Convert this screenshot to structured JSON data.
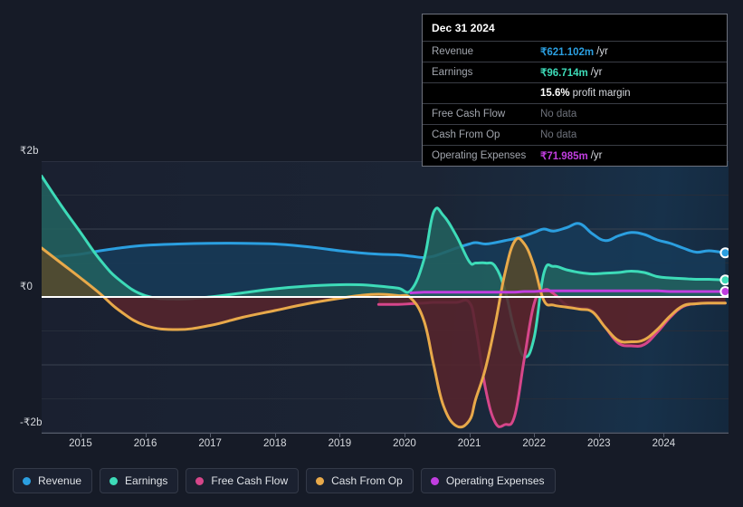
{
  "tooltip": {
    "date": "Dec 31 2024",
    "rows": [
      {
        "label": "Revenue",
        "value": "₹621.102m",
        "suffix": "/yr",
        "style": "v-revenue"
      },
      {
        "label": "Earnings",
        "value": "₹96.714m",
        "suffix": "/yr",
        "style": "v-earnings"
      },
      {
        "label": "",
        "value": "15.6%",
        "suffix": "profit margin",
        "style": "v-white"
      },
      {
        "label": "Free Cash Flow",
        "value": "No data",
        "suffix": "",
        "style": "nodata"
      },
      {
        "label": "Cash From Op",
        "value": "No data",
        "suffix": "",
        "style": "nodata"
      },
      {
        "label": "Operating Expenses",
        "value": "₹71.985m",
        "suffix": "/yr",
        "style": "v-opex"
      }
    ]
  },
  "legend": {
    "items": [
      {
        "label": "Revenue",
        "color": "#2b9fe0"
      },
      {
        "label": "Earnings",
        "color": "#3ddbb8"
      },
      {
        "label": "Free Cash Flow",
        "color": "#d6468a"
      },
      {
        "label": "Cash From Op",
        "color": "#e8a94a"
      },
      {
        "label": "Operating Expenses",
        "color": "#c13ee0"
      }
    ]
  },
  "chart_data": {
    "type": "area",
    "title": "",
    "xlabel": "",
    "ylabel": "",
    "currency": "₹",
    "units": "billions",
    "grid": true,
    "legend_position": "bottom",
    "ylim": [
      -2,
      2
    ],
    "yticks": [
      2,
      1,
      0,
      -1,
      -2
    ],
    "ytick_labels": [
      "₹2b",
      "",
      "₹0",
      "",
      "-₹2b"
    ],
    "gridline_values": [
      2,
      1.5,
      1,
      0.5,
      0,
      -0.5,
      -1,
      -1.5,
      -2
    ],
    "xlim": [
      2014.4,
      2025.0
    ],
    "xticks": [
      2015,
      2016,
      2017,
      2018,
      2019,
      2020,
      2021,
      2022,
      2023,
      2024
    ],
    "xtick_labels": [
      "2015",
      "2016",
      "2017",
      "2018",
      "2019",
      "2020",
      "2021",
      "2022",
      "2023",
      "2024"
    ],
    "zero_line": 0,
    "x": [
      2014.4,
      2014.7,
      2015.0,
      2015.3,
      2015.6,
      2016.0,
      2016.5,
      2017.0,
      2017.5,
      2018.0,
      2018.5,
      2019.0,
      2019.3,
      2019.6,
      2019.9,
      2020.1,
      2020.3,
      2020.45,
      2020.6,
      2020.8,
      2021.0,
      2021.1,
      2021.25,
      2021.4,
      2021.55,
      2021.7,
      2021.85,
      2022.0,
      2022.15,
      2022.3,
      2022.5,
      2022.7,
      2022.9,
      2023.1,
      2023.3,
      2023.5,
      2023.7,
      2023.9,
      2024.1,
      2024.3,
      2024.5,
      2024.7,
      2024.95
    ],
    "series": [
      {
        "name": "Revenue",
        "color": "#2b9fe0",
        "fill": "#173a58",
        "values": [
          0.57,
          0.6,
          0.63,
          0.68,
          0.72,
          0.76,
          0.78,
          0.79,
          0.79,
          0.78,
          0.74,
          0.68,
          0.65,
          0.63,
          0.62,
          0.6,
          0.58,
          0.6,
          0.65,
          0.72,
          0.78,
          0.8,
          0.78,
          0.8,
          0.83,
          0.86,
          0.9,
          0.95,
          1.0,
          0.97,
          1.02,
          1.08,
          0.93,
          0.83,
          0.9,
          0.95,
          0.92,
          0.84,
          0.79,
          0.72,
          0.66,
          0.68,
          0.65
        ],
        "end_marker": true
      },
      {
        "name": "Earnings",
        "color": "#3ddbb8",
        "fill": "#1f5c5c",
        "values": [
          1.78,
          1.35,
          0.95,
          0.55,
          0.25,
          0.02,
          -0.03,
          0.0,
          0.06,
          0.12,
          0.16,
          0.18,
          0.18,
          0.16,
          0.13,
          0.1,
          0.55,
          1.25,
          1.2,
          0.9,
          0.52,
          0.5,
          0.5,
          0.45,
          0.1,
          -0.5,
          -0.88,
          -0.6,
          0.35,
          0.45,
          0.4,
          0.36,
          0.34,
          0.35,
          0.36,
          0.38,
          0.36,
          0.3,
          0.28,
          0.27,
          0.26,
          0.26,
          0.25
        ],
        "end_marker": true
      },
      {
        "name": "Free Cash Flow",
        "color": "#d6468a",
        "fill": "#5e2130",
        "values": [
          null,
          null,
          null,
          null,
          null,
          null,
          null,
          null,
          null,
          null,
          null,
          null,
          null,
          -0.11,
          -0.11,
          -0.1,
          -0.09,
          -0.08,
          -0.08,
          -0.08,
          -0.08,
          -0.45,
          -1.35,
          -1.85,
          -1.88,
          -1.75,
          -0.9,
          -0.1,
          0.1,
          0.05,
          -0.12,
          -0.16,
          -0.2,
          -0.45,
          -0.68,
          -0.72,
          -0.7,
          -0.52,
          -0.3,
          -0.14,
          -0.1,
          -0.09,
          -0.09
        ],
        "end_marker": false
      },
      {
        "name": "Cash From Op",
        "color": "#e8a94a",
        "fill": "#5e2130",
        "values": [
          0.72,
          0.5,
          0.28,
          0.05,
          -0.2,
          -0.42,
          -0.48,
          -0.42,
          -0.3,
          -0.2,
          -0.1,
          -0.02,
          0.02,
          0.04,
          0.02,
          -0.02,
          -0.35,
          -1.0,
          -1.6,
          -1.9,
          -1.82,
          -1.5,
          -1.05,
          -0.4,
          0.35,
          0.82,
          0.78,
          0.45,
          -0.05,
          -0.12,
          -0.15,
          -0.18,
          -0.22,
          -0.45,
          -0.64,
          -0.66,
          -0.63,
          -0.48,
          -0.28,
          -0.13,
          -0.1,
          -0.09,
          -0.09
        ],
        "end_marker": false
      },
      {
        "name": "Operating Expenses",
        "color": "#c13ee0",
        "fill": "none",
        "values": [
          null,
          null,
          null,
          null,
          null,
          null,
          null,
          null,
          null,
          null,
          null,
          null,
          null,
          null,
          null,
          0.06,
          0.07,
          0.07,
          0.07,
          0.07,
          0.07,
          0.07,
          0.07,
          0.07,
          0.07,
          0.07,
          0.08,
          0.08,
          0.09,
          0.09,
          0.09,
          0.09,
          0.09,
          0.09,
          0.09,
          0.09,
          0.09,
          0.09,
          0.08,
          0.08,
          0.08,
          0.08,
          0.08
        ],
        "end_marker": true
      }
    ]
  }
}
